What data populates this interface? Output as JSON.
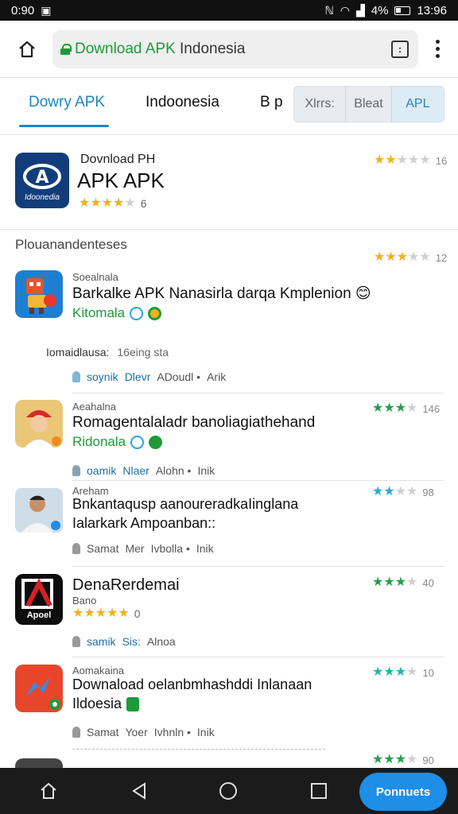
{
  "status_bar": {
    "time": "0:90",
    "battery_text": "4%",
    "clock_right": "13:96"
  },
  "browser": {
    "url_green": "Download APK",
    "url_rest": " Indonesia",
    "tabs_count": ":"
  },
  "tabs": {
    "items": [
      {
        "label": "Dowry APK",
        "active": true
      },
      {
        "label": "Indoonesia",
        "active": false
      },
      {
        "label": "B p",
        "active": false
      }
    ],
    "pill": [
      "Xlrrs:",
      "Bleat",
      "APL"
    ]
  },
  "featured": {
    "icon_label": "Idoonedia",
    "icon_glyph": "A",
    "subtitle": "Dovnload PH",
    "title": "APK APK",
    "stars_gold": 4,
    "rating_count": "6",
    "right_rating": "16",
    "right_stars": 2
  },
  "section": {
    "header": "Plouanandenteses",
    "header_rating": "12",
    "header_stars": 3
  },
  "list": [
    {
      "category": "Soealnala",
      "title": "Barkalke APK Nanasirla darqa Kmplenion",
      "emoji": "😊",
      "tag": "Kitomala",
      "meta_label": "Iomaidlausa:",
      "meta_value": "16eing sta",
      "footer": [
        "soynik",
        "Dlevr",
        "ADoudl •",
        "Arik"
      ]
    },
    {
      "category": "Aeahalna",
      "title": "Romagentalaladr banoliagiathehand",
      "tag": "Ridonala",
      "footer": [
        "oamik",
        "Nlaer",
        "Alohn •",
        "Inik"
      ],
      "right_rating": "146",
      "right_stars": 3
    },
    {
      "category": "Areham",
      "title": "Bnkantaqusp aanoureradkaIinglana",
      "title2": "Ialarkark Ampoanban::",
      "footer": [
        "Samat",
        "Mer",
        "Ivbolla •",
        "Inik"
      ],
      "right_rating": "98",
      "right_stars": 2
    },
    {
      "category": "",
      "title": "DenaRerdemai",
      "sub": "Bano",
      "icon_label": "Apoel",
      "stars_gold": 5,
      "rating_count": "0",
      "footer": [
        "samik",
        "Sis:",
        "Alnoa"
      ],
      "right_rating": "40",
      "right_stars": 3
    },
    {
      "category": "Aomakaina",
      "title": "Downaload oelanbmhashddi Inlanaan",
      "title2": "Ildoesia",
      "footer": [
        "Samat",
        "Yoer",
        "Ivhnln •",
        "Inik"
      ],
      "right_rating": "10",
      "right_stars": 3
    }
  ],
  "last_row": {
    "right_rating": "90",
    "right_stars": 3
  },
  "fab_label": "Ponnuets"
}
